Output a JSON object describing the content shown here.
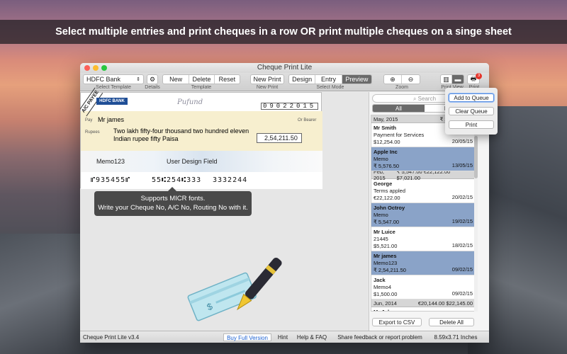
{
  "banner": {
    "text": "Select multiple entries and print cheques in a row OR print multiple cheques on a singe sheet"
  },
  "window": {
    "title": "Cheque Print Lite"
  },
  "toolbar": {
    "bank_select": "HDFC Bank",
    "select_template_caption": "Select Template",
    "details_caption": "Details",
    "template_buttons": [
      "New",
      "Delete",
      "Reset"
    ],
    "template_caption": "Template",
    "new_print_label": "New Print",
    "new_print_caption": "New Print",
    "modes": [
      "Design",
      "Entry",
      "Preview"
    ],
    "active_mode": "Preview",
    "mode_caption": "Select Mode",
    "zoom_caption": "Zoom",
    "print_view_caption": "Print View",
    "print_caption": "Print",
    "print_badge": "3"
  },
  "popup": {
    "add_to_queue": "Add to Queue",
    "clear_queue": "Clear Queue",
    "print": "Print"
  },
  "cheque": {
    "ac_payee": "A/C PAYEE",
    "bank_logo": "HDFC BANK",
    "signature": "Pufund",
    "date": "09022015",
    "pay_label": "Pay",
    "payee": "Mr james",
    "or_bearer": "Or Bearer",
    "rupees_label": "Rupees",
    "amount_words": "Two lakh fifty-four thousand two hundred eleven Indian rupee fifty Paisa",
    "amount": "2,54,211.50",
    "memo": "Memo123",
    "design_field": "User Design Field",
    "micr": [
      "⑈935455⑈",
      "55⑆254⑆333",
      "3332244"
    ]
  },
  "tooltip": {
    "line1": "Supports MICR fonts.",
    "line2": "Write your Cheque No, A/C No, Routing No with it."
  },
  "sidebar": {
    "search_placeholder": "Search",
    "tabs": [
      "All",
      "Draft"
    ],
    "groups": [
      {
        "month": "May, 2015",
        "total": "₹ 2,59,788.00",
        "entries": [
          {
            "name": "Mr Smith",
            "memo": "Payment for Services",
            "amount": "$12,254.00",
            "date": "20/05/15",
            "selected": false
          },
          {
            "name": "Apple Inc",
            "memo": "Memo",
            "amount": "₹ 5,576.50",
            "date": "13/05/15",
            "selected": true
          }
        ]
      },
      {
        "month": "Feb, 2015",
        "total": "₹ 5,547.00 €22,122.00 $7,021.00",
        "entries": [
          {
            "name": "George",
            "memo": "Terms appled",
            "amount": "€22,122.00",
            "date": "20/02/15",
            "selected": false
          },
          {
            "name": "John Octroy",
            "memo": "Memo",
            "amount": "₹ 5,547.00",
            "date": "19/02/15",
            "selected": true
          },
          {
            "name": "Mr Luice",
            "memo": "21445",
            "amount": "$5,521.00",
            "date": "18/02/15",
            "selected": false
          },
          {
            "name": "Mr james",
            "memo": "Memo123",
            "amount": "₹ 2,54,211.50",
            "date": "09/02/15",
            "selected": true
          },
          {
            "name": "Jack",
            "memo": "Memo4",
            "amount": "$1,500.00",
            "date": "09/02/15",
            "selected": false
          }
        ]
      },
      {
        "month": "Jun, 2014",
        "total": "€20,144.00 $22,145.00",
        "entries": [
          {
            "name": "Mr John",
            "memo": "",
            "amount": "",
            "date": "",
            "selected": false
          }
        ]
      }
    ],
    "export_csv": "Export to CSV",
    "delete_all": "Delete All"
  },
  "statusbar": {
    "version": "Cheque Print Lite v3.4",
    "buy": "Buy Full Version",
    "hint": "Hint",
    "help": "Help & FAQ",
    "feedback": "Share feedback or report problem",
    "size": "8.59x3.71 Inches"
  },
  "colors": {
    "selected_row": "#8aa3c8",
    "active_segment": "#6a6a6a",
    "buy_link": "#1a5fd0"
  }
}
